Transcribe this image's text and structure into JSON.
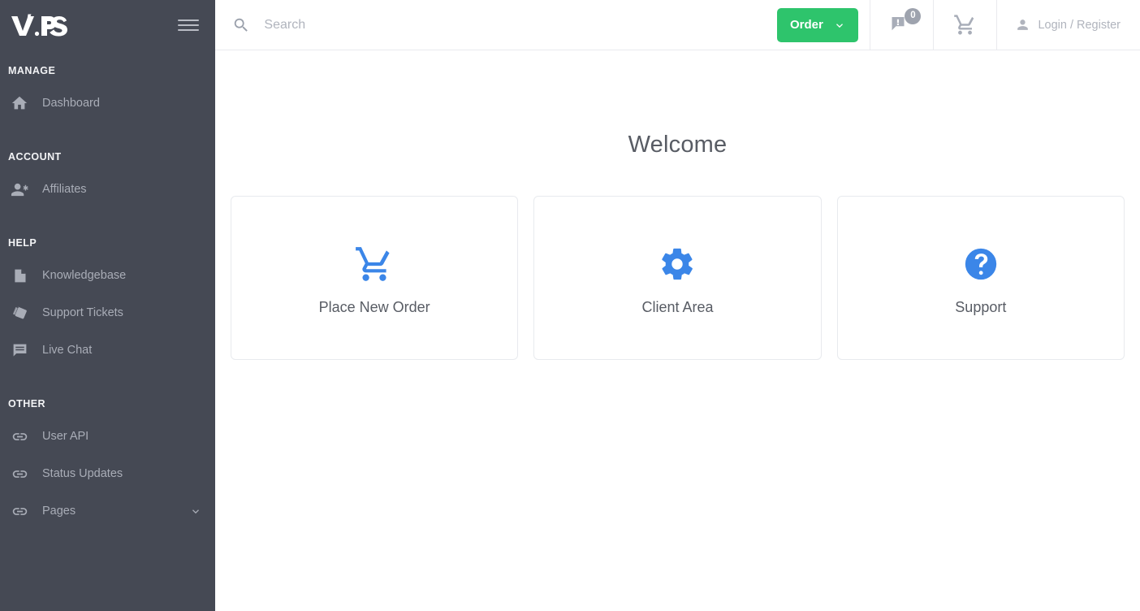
{
  "brand": {
    "logo_text": "V.PS",
    "menu_toggle": "hamburger-menu"
  },
  "colors": {
    "sidebar_bg": "#454954",
    "accent_green": "#2ec46c",
    "accent_blue": "#3b86e8",
    "text_muted": "#a9adb7",
    "heading": "#585c64"
  },
  "sidebar": {
    "sections": [
      {
        "title": "MANAGE",
        "items": [
          {
            "label": "Dashboard",
            "icon": "home-icon",
            "has_caret": false
          }
        ]
      },
      {
        "title": "ACCOUNT",
        "items": [
          {
            "label": "Affiliates",
            "icon": "person-add-icon",
            "has_caret": false
          }
        ]
      },
      {
        "title": "HELP",
        "items": [
          {
            "label": "Knowledgebase",
            "icon": "document-icon",
            "has_caret": false
          },
          {
            "label": "Support Tickets",
            "icon": "ticket-icon",
            "has_caret": false
          },
          {
            "label": "Live Chat",
            "icon": "chat-icon",
            "has_caret": false
          }
        ]
      },
      {
        "title": "OTHER",
        "items": [
          {
            "label": "User API",
            "icon": "link-icon",
            "has_caret": false
          },
          {
            "label": "Status Updates",
            "icon": "link-icon",
            "has_caret": false
          },
          {
            "label": "Pages",
            "icon": "link-icon",
            "has_caret": true
          }
        ]
      }
    ]
  },
  "topbar": {
    "search": {
      "placeholder": "Search",
      "value": "",
      "icon": "search-icon"
    },
    "order_button": {
      "label": "Order",
      "caret": "chevron-down-icon"
    },
    "announcements": {
      "icon": "announcement-icon",
      "badge_count": "0"
    },
    "cart": {
      "icon": "shopping-cart-icon"
    },
    "account": {
      "label": "Login / Register",
      "icon": "person-icon"
    }
  },
  "main": {
    "heading": "Welcome",
    "cards": [
      {
        "label": "Place New Order",
        "icon": "shopping-cart-icon"
      },
      {
        "label": "Client Area",
        "icon": "gear-icon"
      },
      {
        "label": "Support",
        "icon": "help-circle-icon"
      }
    ]
  }
}
